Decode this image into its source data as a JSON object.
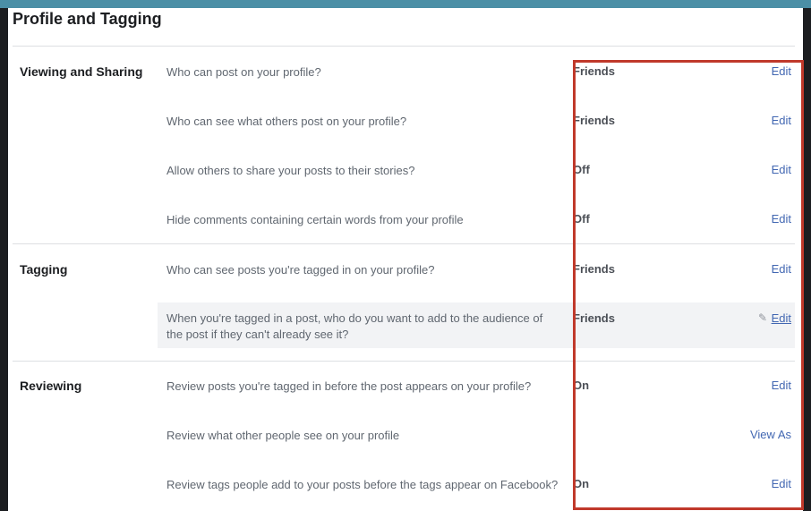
{
  "page_title": "Profile and Tagging",
  "sections": [
    {
      "label": "Viewing and Sharing",
      "rows": [
        {
          "question": "Who can post on your profile?",
          "value": "Friends",
          "action": "Edit"
        },
        {
          "question": "Who can see what others post on your profile?",
          "value": "Friends",
          "action": "Edit"
        },
        {
          "question": "Allow others to share your posts to their stories?",
          "value": "Off",
          "action": "Edit"
        },
        {
          "question": "Hide comments containing certain words from your profile",
          "value": "Off",
          "action": "Edit"
        }
      ]
    },
    {
      "label": "Tagging",
      "rows": [
        {
          "question": "Who can see posts you're tagged in on your profile?",
          "value": "Friends",
          "action": "Edit"
        },
        {
          "question": "When you're tagged in a post, who do you want to add to the audience of the post if they can't already see it?",
          "value": "Friends",
          "action": "Edit"
        }
      ]
    },
    {
      "label": "Reviewing",
      "rows": [
        {
          "question": "Review posts you're tagged in before the post appears on your profile?",
          "value": "On",
          "action": "Edit"
        },
        {
          "question": "Review what other people see on your profile",
          "value": "",
          "action": "View As"
        },
        {
          "question": "Review tags people add to your posts before the tags appear on Facebook?",
          "value": "On",
          "action": "Edit"
        }
      ]
    }
  ],
  "icons": {
    "edit_pencil": "pencil-icon"
  },
  "colors": {
    "link": "#4267b2",
    "highlight_box": "#c0392b",
    "top_bar": "#4b8fa6"
  }
}
